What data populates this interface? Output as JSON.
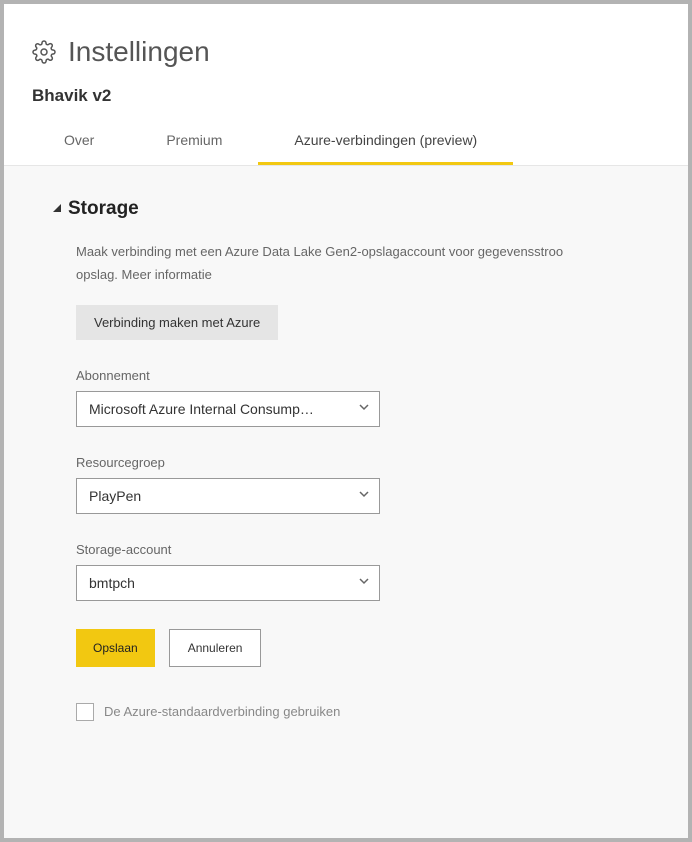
{
  "header": {
    "title": "Instellingen",
    "subtitle": "Bhavik v2"
  },
  "tabs": [
    {
      "label": "Over",
      "active": false
    },
    {
      "label": "Premium",
      "active": false
    },
    {
      "label": "Azure-verbindingen (preview)",
      "active": true
    }
  ],
  "section": {
    "title": "Storage",
    "description": "Maak verbinding met een Azure Data Lake Gen2-opslagaccount voor gegevensstroo",
    "description_suffix": "opslag.",
    "more_info_link": "Meer informatie",
    "connect_button": "Verbinding maken met Azure"
  },
  "form": {
    "subscription": {
      "label": "Abonnement",
      "value": "Microsoft Azure Internal Consump…"
    },
    "resource_group": {
      "label": "Resourcegroep",
      "value": "PlayPen"
    },
    "storage_account": {
      "label": "Storage-account",
      "value": "bmtpch"
    }
  },
  "buttons": {
    "save": "Opslaan",
    "cancel": "Annuleren"
  },
  "checkbox": {
    "label": "De Azure-standaardverbinding gebruiken"
  }
}
